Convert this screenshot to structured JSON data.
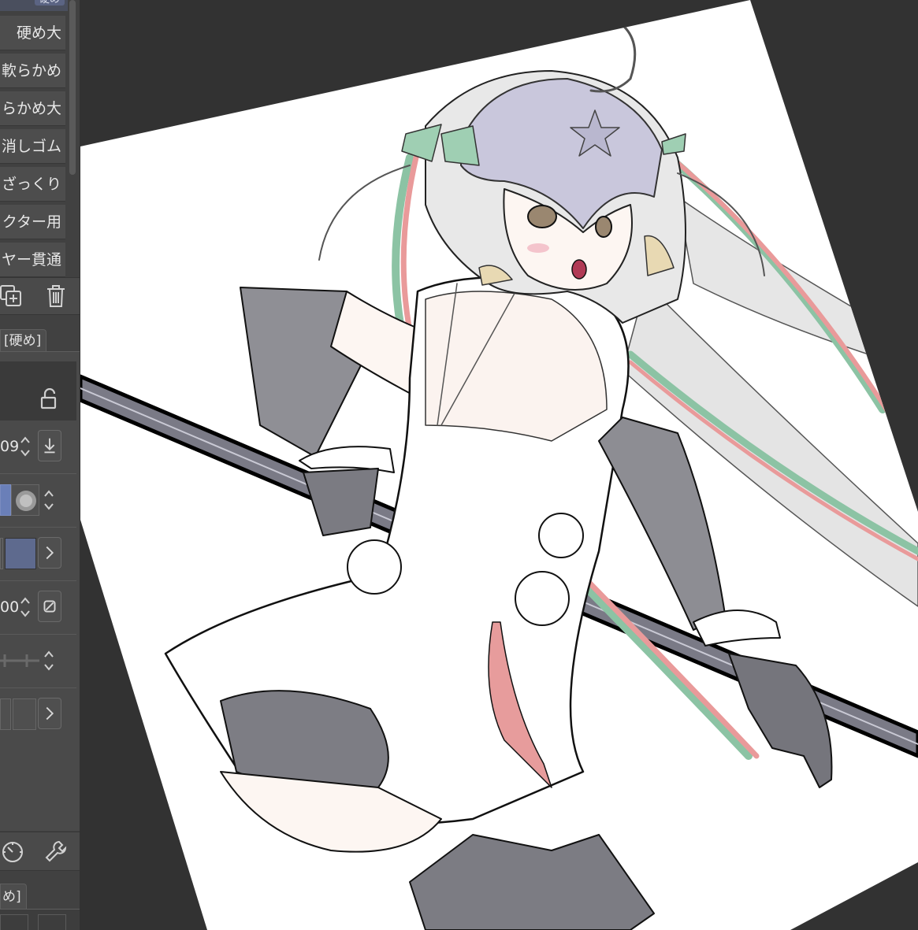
{
  "subtool_list": {
    "header_tab": "硬め",
    "items": [
      {
        "label": "硬め大"
      },
      {
        "label": "軟らかめ"
      },
      {
        "label": "らかめ大"
      },
      {
        "label": "消しゴム"
      },
      {
        "label": "ざっくり"
      },
      {
        "label": "クター用"
      },
      {
        "label": "ヤー貫通"
      }
    ]
  },
  "tool_property": {
    "tab_label": "[硬め]",
    "brush_size_value": "09",
    "opacity_value": "00"
  },
  "bottom_tab": {
    "label": "め]"
  },
  "canvas": {
    "background_color": "#323232",
    "paper_color": "#ffffff"
  }
}
